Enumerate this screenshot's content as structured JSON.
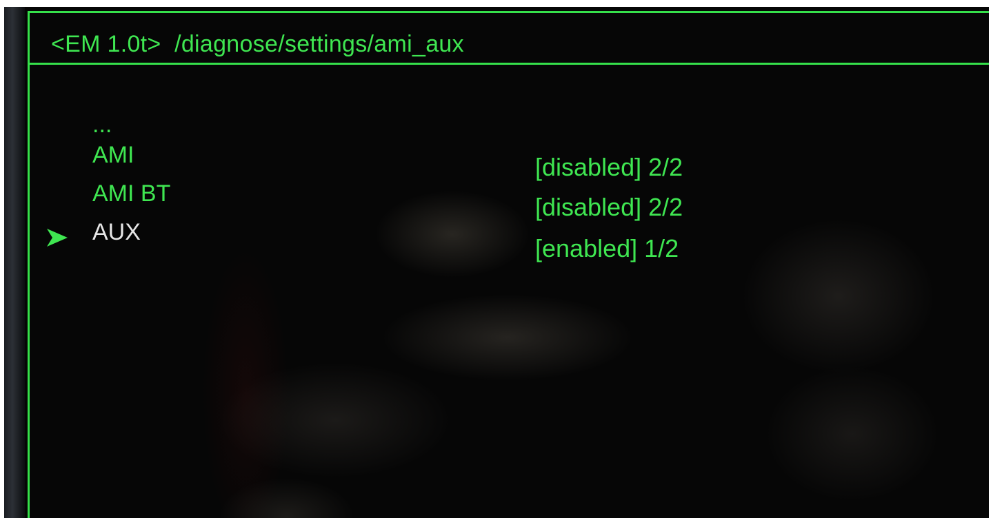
{
  "title_bar": {
    "module": "<EM 1.0t>",
    "path": "/diagnose/settings/ami_aux"
  },
  "menu": {
    "items": [
      {
        "label": "...",
        "selected": false
      },
      {
        "label": "AMI",
        "selected": false
      },
      {
        "label": "AMI BT",
        "selected": false
      },
      {
        "label": "AUX",
        "selected": true
      }
    ],
    "cursor_icon": "triangle-right-icon"
  },
  "values": [
    {
      "text": "[disabled] 2/2"
    },
    {
      "text": "[disabled] 2/2"
    },
    {
      "text": "[enabled] 1/2"
    }
  ],
  "colors": {
    "text_green": "#3fe651",
    "frame_green": "#35e04a",
    "selected_text": "#e6e6e6",
    "background": "#060606"
  }
}
